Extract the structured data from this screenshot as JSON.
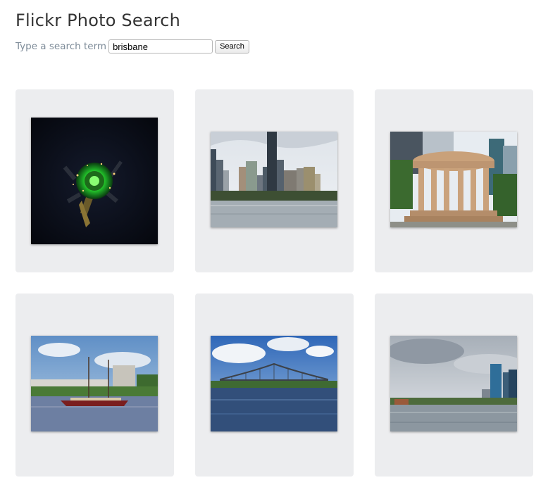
{
  "header": {
    "title": "Flickr Photo Search"
  },
  "search": {
    "label": "Type a search term",
    "value": "brisbane",
    "button_label": "Search"
  },
  "results": {
    "photos": [
      {
        "icon": "tiny-planet-night-photo"
      },
      {
        "icon": "river-skyline-photo"
      },
      {
        "icon": "memorial-rotunda-photo"
      },
      {
        "icon": "tall-ship-river-photo"
      },
      {
        "icon": "story-bridge-photo"
      },
      {
        "icon": "river-towers-photo"
      }
    ]
  }
}
